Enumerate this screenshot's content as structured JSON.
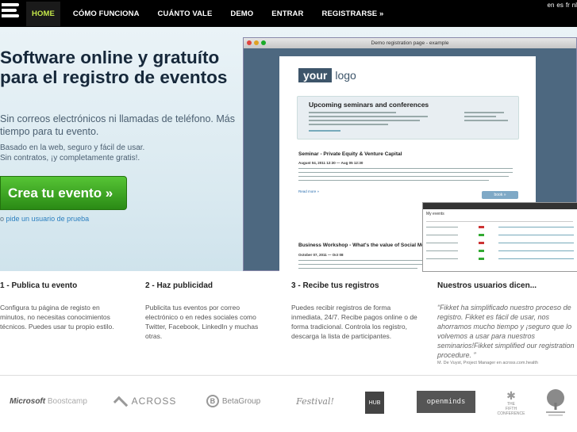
{
  "nav": {
    "items": [
      "HOME",
      "CÓMO FUNCIONA",
      "CUÁNTO VALE",
      "DEMO",
      "ENTRAR",
      "REGISTRARSE »"
    ],
    "langs": [
      "en",
      "es",
      "fr",
      "nl"
    ]
  },
  "hero": {
    "title": "Software online y gratuíto para el registro de eventos",
    "subtitle": "Sin correos electrónicos ni llamadas de teléfono. Más tiempo para tu evento.",
    "desc_line1": "Basado en la web, seguro y fácil de usar.",
    "desc_line2": "Sin contratos, ¡y completamente gratis!.",
    "cta": "Crea tu evento »",
    "alt_prefix": "o",
    "alt_link": "pide un usuario de prueba"
  },
  "demo": {
    "window_title": "Demo registration page - example",
    "your": "your",
    "logo": "logo",
    "upcoming": "Upcoming seminars and conferences",
    "seminar1": "Seminar - Private Equity & Venture Capital",
    "seminar1_date": "August 04, 2011 12:30 — Aug 05 12:30",
    "read_more": "Read more »",
    "book": "book »",
    "seminar2": "Business Workshop - What's the value of Social Med",
    "seminar2_date": "October 07, 2011 — Oct 08",
    "inner_title": "My events"
  },
  "features": [
    {
      "title": "1 - Publica tu evento",
      "text": "Configura tu página de registo en minutos, no necesitas conocimientos técnicos. Puedes usar tu propio estilo."
    },
    {
      "title": "2 - Haz publicidad",
      "text": "Publicita tus eventos por correo electrónico o en redes sociales como Twitter, Facebook, LinkedIn y muchas otras."
    },
    {
      "title": "3 - Recibe tus registros",
      "text": "Puedes recibir registros de forma inmediata, 24/7. Recibe pagos online o de forma tradicional. Controla los registro, descarga la lista de participantes."
    }
  ],
  "testimonial": {
    "title": "Nuestros usuarios dicen...",
    "quote": "“Fikket ha simplificado nuestro proceso de registro. Fikket es fácil de usar, nos ahorramos mucho tiempo y ¡seguro que lo volvemos a usar para nuestros seminarios!Fikket simplified our registration procedure. ”",
    "author": "M. De Vuyst, Project Manager en across.com.health"
  },
  "logos": {
    "microsoft": "Microsoft",
    "boostcamp": "Boostcamp",
    "across": "ACROSS",
    "betagroup": "BetaGroup",
    "festival": "Festival!",
    "hub": "HUB",
    "openminds": "openminds",
    "fifth_the": "THE",
    "fifth_fifth": "FIFTH",
    "fifth_conference": "CONFERENCE"
  },
  "colors": {
    "nav_bg": "#000000",
    "nav_active": "#c5e84a",
    "cta_green": "#3aa620",
    "hero_title": "#16283a"
  }
}
